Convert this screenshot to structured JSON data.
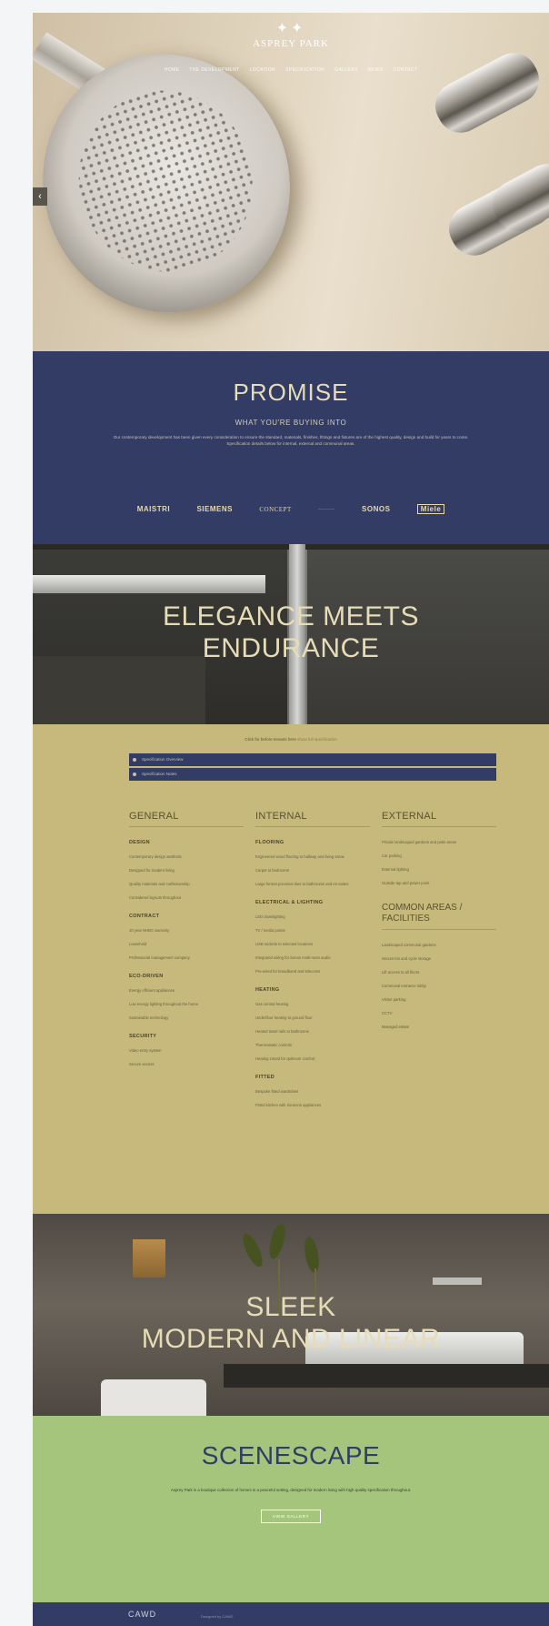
{
  "hero": {
    "logo_mark": "✦✦",
    "logo_name": "ASPREY PARK",
    "nav": [
      "Home",
      "The Development",
      "Location",
      "Specification",
      "Gallery",
      "News",
      "Contact"
    ],
    "prev_arrow": "‹"
  },
  "promise": {
    "title": "PROMISE",
    "subtitle": "WHAT YOU'RE BUYING INTO",
    "body": "Our contemporary development has been given every consideration to ensure the standard, materials, finishes, fittings and fixtures are of the highest quality, design and build for years to come. Specification details below for internal, external and communal areas.",
    "brands": [
      "MAISTRI",
      "SIEMENS",
      "CONCEPT",
      "",
      "SONOS",
      "Miele"
    ]
  },
  "elegance": {
    "line1": "ELEGANCE MEETS",
    "line2": "ENDURANCE"
  },
  "spec": {
    "note": "Click for before tenants here",
    "note_link": "show full specification",
    "accordions": [
      "Specification Overview",
      "Specification Notes"
    ],
    "general": {
      "heading": "GENERAL",
      "design": {
        "title": "DESIGN",
        "items": [
          "Contemporary design aesthetic",
          "Designed for modern living",
          "Quality materials and craftsmanship",
          "Considered layouts throughout"
        ]
      },
      "contract": {
        "title": "CONTRACT",
        "items": [
          "10 year NHBC warranty",
          "Leasehold",
          "Professional management company"
        ]
      },
      "ecodriven": {
        "title": "ECO-DRIVEN",
        "items": [
          "Energy efficient appliances",
          "Low energy lighting throughout the home",
          "Sustainable technology"
        ]
      },
      "security": {
        "title": "SECURITY",
        "items": [
          "Video entry system",
          "Secure access"
        ]
      }
    },
    "internal": {
      "heading": "INTERNAL",
      "flooring": {
        "title": "FLOORING",
        "items": [
          "Engineered wood flooring to hallway and living areas",
          "Carpet to bedrooms",
          "Large format porcelain tiles to bathrooms and en-suites"
        ]
      },
      "electrical": {
        "title": "ELECTRICAL & LIGHTING",
        "items": [
          "LED downlighting",
          "TV / media points",
          "USB sockets to selected locations",
          "Integrated wiring for Sonos multi-room audio",
          "Pre-wired for broadband and telecoms"
        ]
      },
      "heating": {
        "title": "HEATING",
        "items": [
          "Gas central heating",
          "Underfloor heating to ground floor",
          "Heated towel rails to bathrooms",
          "Thermostatic controls",
          "Heating zoned for optimum comfort"
        ]
      },
      "fitted": {
        "title": "FITTED",
        "items": [
          "Bespoke fitted wardrobes",
          "Fitted kitchen with Siemens appliances"
        ]
      }
    },
    "external": {
      "heading": "EXTERNAL",
      "items": [
        "Private landscaped gardens and patio areas",
        "Car parking",
        "External lighting",
        "Outside tap and power point"
      ],
      "common_heading": "COMMON AREAS / FACILITIES",
      "common_items": [
        "Landscaped communal gardens",
        "Secure bin and cycle storage",
        "Lift access to all floors",
        "Communal entrance lobby",
        "Visitor parking",
        "CCTV",
        "Managed estate"
      ]
    }
  },
  "sleek": {
    "line1": "SLEEK",
    "line2": "MODERN AND LINEAR"
  },
  "scenescape": {
    "title": "SCENESCAPE",
    "body": "Asprey Park is a boutique collection of homes in a peaceful setting, designed for modern living with high quality specification throughout.",
    "button": "VIEW GALLERY"
  },
  "footer": {
    "brand": "CAWD",
    "small": "Designed by CAWD"
  }
}
